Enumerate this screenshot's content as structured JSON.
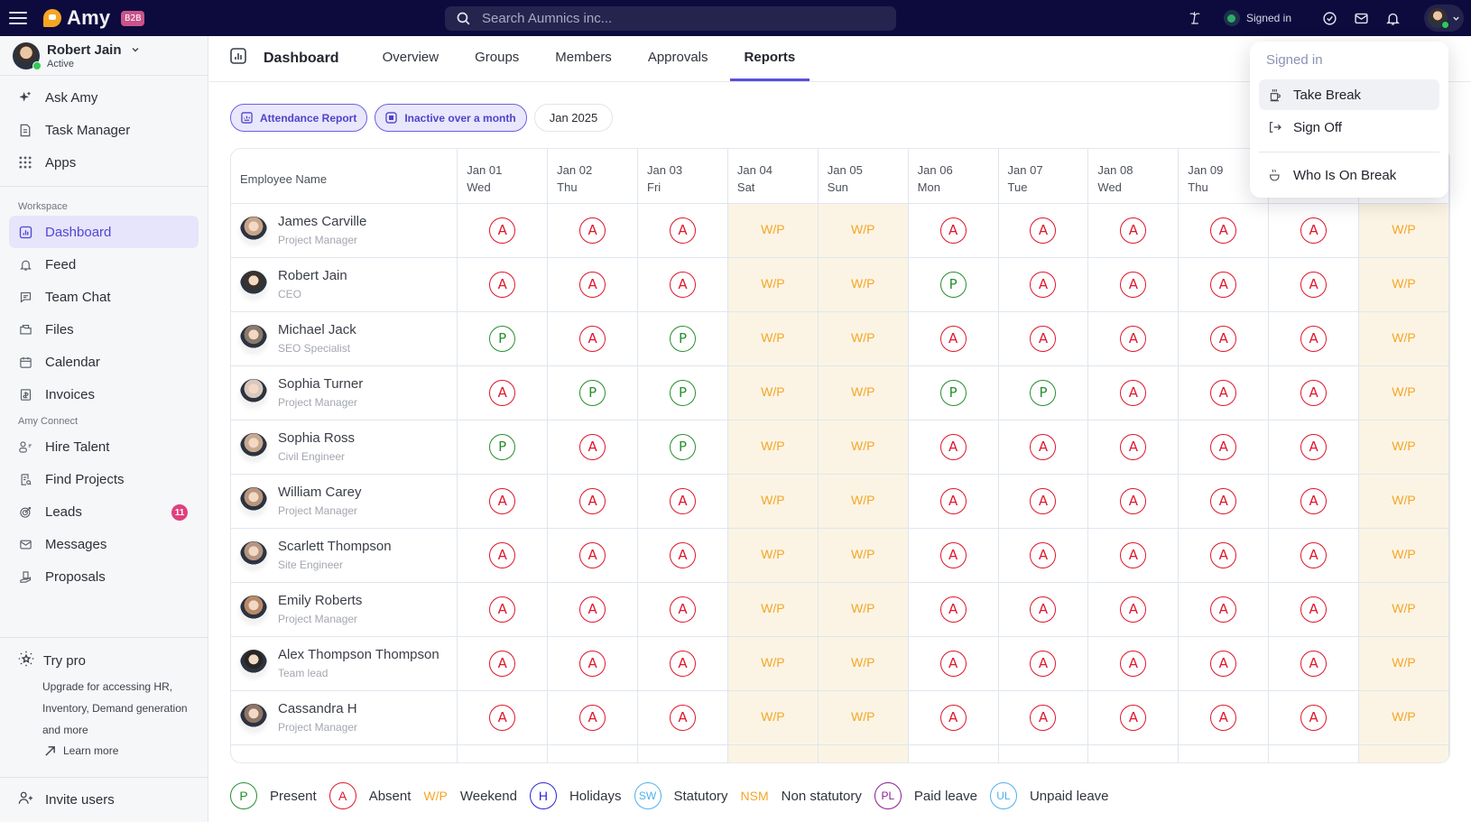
{
  "app": {
    "name": "Amy",
    "badge": "B2B",
    "search_placeholder": "Search Aumnics inc...",
    "status_label": "Signed in",
    "colors": {
      "topbar": "#0d0b3e",
      "accent": "#5b4fdb",
      "present": "#278f2e",
      "absent": "#e0162b",
      "weekend": "#f4a626",
      "badge": "#e0407f"
    }
  },
  "profile": {
    "name": "Robert Jain",
    "status": "Active"
  },
  "sidebar": {
    "top_items": [
      {
        "label": "Ask Amy",
        "icon": "sparkle-icon"
      },
      {
        "label": "Task Manager",
        "icon": "document-icon"
      },
      {
        "label": "Apps",
        "icon": "grid-icon"
      }
    ],
    "workspace_label": "Workspace",
    "workspace_items": [
      {
        "label": "Dashboard",
        "icon": "chart-icon",
        "active": true
      },
      {
        "label": "Feed",
        "icon": "bell-icon"
      },
      {
        "label": "Team Chat",
        "icon": "chat-icon"
      },
      {
        "label": "Files",
        "icon": "folder-icon"
      },
      {
        "label": "Calendar",
        "icon": "calendar-icon"
      },
      {
        "label": "Invoices",
        "icon": "invoice-icon"
      }
    ],
    "connect_label": "Amy Connect",
    "connect_items": [
      {
        "label": "Hire Talent",
        "icon": "hire-icon"
      },
      {
        "label": "Find Projects",
        "icon": "find-projects-icon"
      },
      {
        "label": "Leads",
        "icon": "target-icon",
        "badge": "11"
      },
      {
        "label": "Messages",
        "icon": "mail-icon"
      },
      {
        "label": "Proposals",
        "icon": "proposal-icon"
      }
    ],
    "try_pro": {
      "title": "Try pro",
      "description": "Upgrade for accessing HR, Inventory, Demand generation and more",
      "link": "Learn more"
    },
    "invite": "Invite users"
  },
  "header": {
    "title": "Dashboard",
    "tabs": [
      {
        "label": "Overview"
      },
      {
        "label": "Groups"
      },
      {
        "label": "Members"
      },
      {
        "label": "Approvals"
      },
      {
        "label": "Reports",
        "active": true
      }
    ]
  },
  "filters": {
    "report": "Attendance Report",
    "inactive": "Inactive over a month",
    "month": "Jan 2025"
  },
  "table": {
    "name_header": "Employee Name",
    "days": [
      {
        "date": "Jan 01",
        "dow": "Wed",
        "weekend": false
      },
      {
        "date": "Jan 02",
        "dow": "Thu",
        "weekend": false
      },
      {
        "date": "Jan 03",
        "dow": "Fri",
        "weekend": false
      },
      {
        "date": "Jan 04",
        "dow": "Sat",
        "weekend": true
      },
      {
        "date": "Jan 05",
        "dow": "Sun",
        "weekend": true
      },
      {
        "date": "Jan 06",
        "dow": "Mon",
        "weekend": false
      },
      {
        "date": "Jan 07",
        "dow": "Tue",
        "weekend": false
      },
      {
        "date": "Jan 08",
        "dow": "Wed",
        "weekend": false
      },
      {
        "date": "Jan 09",
        "dow": "Thu",
        "weekend": false
      },
      {
        "date": "",
        "dow": "",
        "weekend": false
      },
      {
        "date": "",
        "dow": "",
        "weekend": true
      }
    ],
    "rows": [
      {
        "name": "James Carville",
        "role": "Project Manager",
        "avatar": "#c9a489",
        "marks": [
          "A",
          "A",
          "A",
          "W/P",
          "W/P",
          "A",
          "A",
          "A",
          "A",
          "A",
          "W/P"
        ]
      },
      {
        "name": "Robert Jain",
        "role": "CEO",
        "avatar": "#3a322c",
        "marks": [
          "A",
          "A",
          "A",
          "W/P",
          "W/P",
          "P",
          "A",
          "A",
          "A",
          "A",
          "W/P"
        ]
      },
      {
        "name": "Michael Jack",
        "role": "SEO Specialist",
        "avatar": "#8a7a6c",
        "marks": [
          "P",
          "A",
          "P",
          "W/P",
          "W/P",
          "A",
          "A",
          "A",
          "A",
          "A",
          "W/P"
        ]
      },
      {
        "name": "Sophia Turner",
        "role": "Project Manager",
        "avatar": "#d9c8bc",
        "marks": [
          "A",
          "P",
          "P",
          "W/P",
          "W/P",
          "P",
          "P",
          "A",
          "A",
          "A",
          "W/P"
        ]
      },
      {
        "name": "Sophia Ross",
        "role": "Civil Engineer",
        "avatar": "#c7a98f",
        "marks": [
          "P",
          "A",
          "P",
          "W/P",
          "W/P",
          "A",
          "A",
          "A",
          "A",
          "A",
          "W/P"
        ]
      },
      {
        "name": "William Carey",
        "role": "Project Manager",
        "avatar": "#b8957c",
        "marks": [
          "A",
          "A",
          "A",
          "W/P",
          "W/P",
          "A",
          "A",
          "A",
          "A",
          "A",
          "W/P"
        ]
      },
      {
        "name": "Scarlett Thompson",
        "role": "Site Engineer",
        "avatar": "#b59580",
        "marks": [
          "A",
          "A",
          "A",
          "W/P",
          "W/P",
          "A",
          "A",
          "A",
          "A",
          "A",
          "W/P"
        ]
      },
      {
        "name": "Emily Roberts",
        "role": "Project Manager",
        "avatar": "#b98a68",
        "marks": [
          "A",
          "A",
          "A",
          "W/P",
          "W/P",
          "A",
          "A",
          "A",
          "A",
          "A",
          "W/P"
        ]
      },
      {
        "name": "Alex Thompson Thompson",
        "role": "Team lead",
        "avatar": "#2a2623",
        "marks": [
          "A",
          "A",
          "A",
          "W/P",
          "W/P",
          "A",
          "A",
          "A",
          "A",
          "A",
          "W/P"
        ]
      },
      {
        "name": "Cassandra H",
        "role": "Project Manager",
        "avatar": "#8f7566",
        "marks": [
          "A",
          "A",
          "A",
          "W/P",
          "W/P",
          "A",
          "A",
          "A",
          "A",
          "A",
          "W/P"
        ]
      }
    ]
  },
  "legend": [
    {
      "symbol": "P",
      "label": "Present",
      "style": "circle",
      "color": "#278f2e"
    },
    {
      "symbol": "A",
      "label": "Absent",
      "style": "circle",
      "color": "#e0162b"
    },
    {
      "symbol": "W/P",
      "label": "Weekend",
      "style": "text",
      "color": "#f4a626"
    },
    {
      "symbol": "H",
      "label": "Holidays",
      "style": "circle",
      "color": "#2a24d6"
    },
    {
      "symbol": "SW",
      "label": "Statutory",
      "style": "circle",
      "color": "#4fb1ea"
    },
    {
      "symbol": "NSM",
      "label": "Non statutory",
      "style": "text",
      "color": "#f4a626"
    },
    {
      "symbol": "PL",
      "label": "Paid leave",
      "style": "circle",
      "color": "#8a1e8e"
    },
    {
      "symbol": "UL",
      "label": "Unpaid leave",
      "style": "circle",
      "color": "#4fb1ea"
    }
  ],
  "status_menu": {
    "header": "Signed in",
    "items": [
      {
        "label": "Take Break",
        "icon": "coffee-cup-icon"
      },
      {
        "label": "Sign Off",
        "icon": "sign-out-icon"
      },
      {
        "label": "Who Is On Break",
        "icon": "hot-drink-icon"
      }
    ]
  }
}
